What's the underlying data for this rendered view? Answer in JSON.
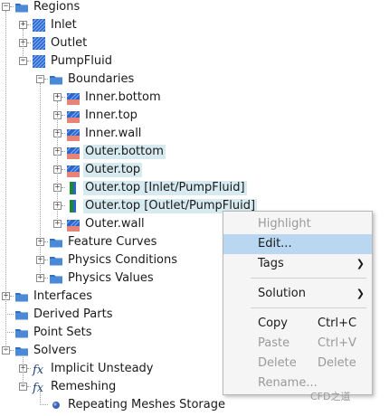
{
  "tree": [
    {
      "label": "Regions",
      "exp": "minus",
      "icon": "folder-icon"
    },
    {
      "label": "Inlet",
      "exp": "plus",
      "icon": "region-icon"
    },
    {
      "label": "Outlet",
      "exp": "plus",
      "icon": "region-icon"
    },
    {
      "label": "PumpFluid",
      "exp": "minus",
      "icon": "region-icon"
    },
    {
      "label": "Boundaries",
      "exp": "minus",
      "icon": "folder-icon"
    },
    {
      "label": "Inner.bottom",
      "exp": "plus",
      "icon": "boundary-icon"
    },
    {
      "label": "Inner.top",
      "exp": "plus",
      "icon": "boundary-icon"
    },
    {
      "label": "Inner.wall",
      "exp": "plus",
      "icon": "boundary-icon"
    },
    {
      "label": "Outer.bottom",
      "exp": "plus",
      "icon": "boundary-icon",
      "selected": true
    },
    {
      "label": "Outer.top",
      "exp": "plus",
      "icon": "boundary-icon",
      "selected": true
    },
    {
      "label": "Outer.top [Inlet/PumpFluid]",
      "exp": "plus",
      "icon": "interface-boundary-icon",
      "selected": true
    },
    {
      "label": "Outer.top [Outlet/PumpFluid]",
      "exp": "plus",
      "icon": "interface-boundary-icon",
      "selected": true
    },
    {
      "label": "Outer.wall",
      "exp": "plus",
      "icon": "boundary-icon"
    },
    {
      "label": "Feature Curves",
      "exp": "plus",
      "icon": "folder-icon"
    },
    {
      "label": "Physics Conditions",
      "exp": "plus",
      "icon": "folder-icon"
    },
    {
      "label": "Physics Values",
      "exp": "plus",
      "icon": "folder-icon"
    },
    {
      "label": "Interfaces",
      "exp": "plus",
      "icon": "folder-icon"
    },
    {
      "label": "Derived Parts",
      "exp": "none",
      "icon": "folder-icon"
    },
    {
      "label": "Point Sets",
      "exp": "none",
      "icon": "folder-icon"
    },
    {
      "label": "Solvers",
      "exp": "minus",
      "icon": "folder-icon"
    },
    {
      "label": "Implicit Unsteady",
      "exp": "plus",
      "icon": "fx-icon"
    },
    {
      "label": "Remeshing",
      "exp": "minus",
      "icon": "fx-icon"
    },
    {
      "label": "Repeating Meshes Storage",
      "exp": "none",
      "icon": "dot-icon"
    }
  ],
  "context_menu": {
    "highlight": "Highlight",
    "edit": "Edit...",
    "tags": "Tags",
    "solution": "Solution",
    "copy": "Copy",
    "copy_shortcut": "Ctrl+C",
    "paste": "Paste",
    "paste_shortcut": "Ctrl+V",
    "delete": "Delete",
    "delete_shortcut": "Delete",
    "rename": "Rename..."
  },
  "watermark": "CFD之道",
  "colors": {
    "selection": "#d6eaf0",
    "menu_hover": "#b9d7f0",
    "folder_blue": "#2f6fc4",
    "boundary_red": "#d63a2a"
  }
}
